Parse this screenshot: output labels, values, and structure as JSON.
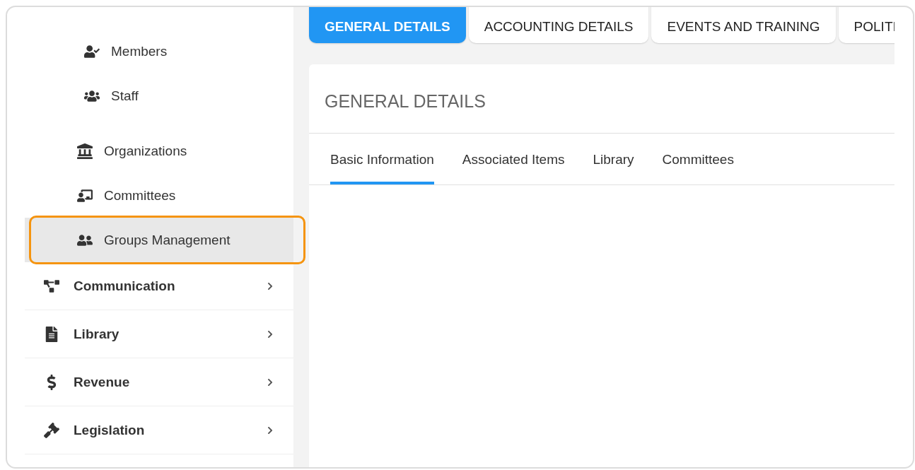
{
  "sidebar": {
    "groups": [
      {
        "items": [
          {
            "label": "Members",
            "selected": false
          },
          {
            "label": "Staff",
            "selected": false
          }
        ]
      },
      {
        "items": [
          {
            "label": "Organizations",
            "selected": false
          },
          {
            "label": "Committees",
            "selected": false
          },
          {
            "label": "Groups Management",
            "selected": true
          }
        ]
      }
    ],
    "sections": [
      {
        "label": "Communication"
      },
      {
        "label": "Library"
      },
      {
        "label": "Revenue"
      },
      {
        "label": "Legislation"
      }
    ]
  },
  "tabs": [
    {
      "label": "GENERAL DETAILS",
      "selected": true
    },
    {
      "label": "ACCOUNTING DETAILS",
      "selected": false
    },
    {
      "label": "EVENTS AND TRAINING",
      "selected": false
    },
    {
      "label": "POLITI",
      "selected": false
    }
  ],
  "panel": {
    "title": "GENERAL DETAILS",
    "subtabs": [
      {
        "label": "Basic Information",
        "selected": true
      },
      {
        "label": "Associated Items",
        "selected": false
      },
      {
        "label": "Library",
        "selected": false
      },
      {
        "label": "Committees",
        "selected": false
      }
    ]
  }
}
